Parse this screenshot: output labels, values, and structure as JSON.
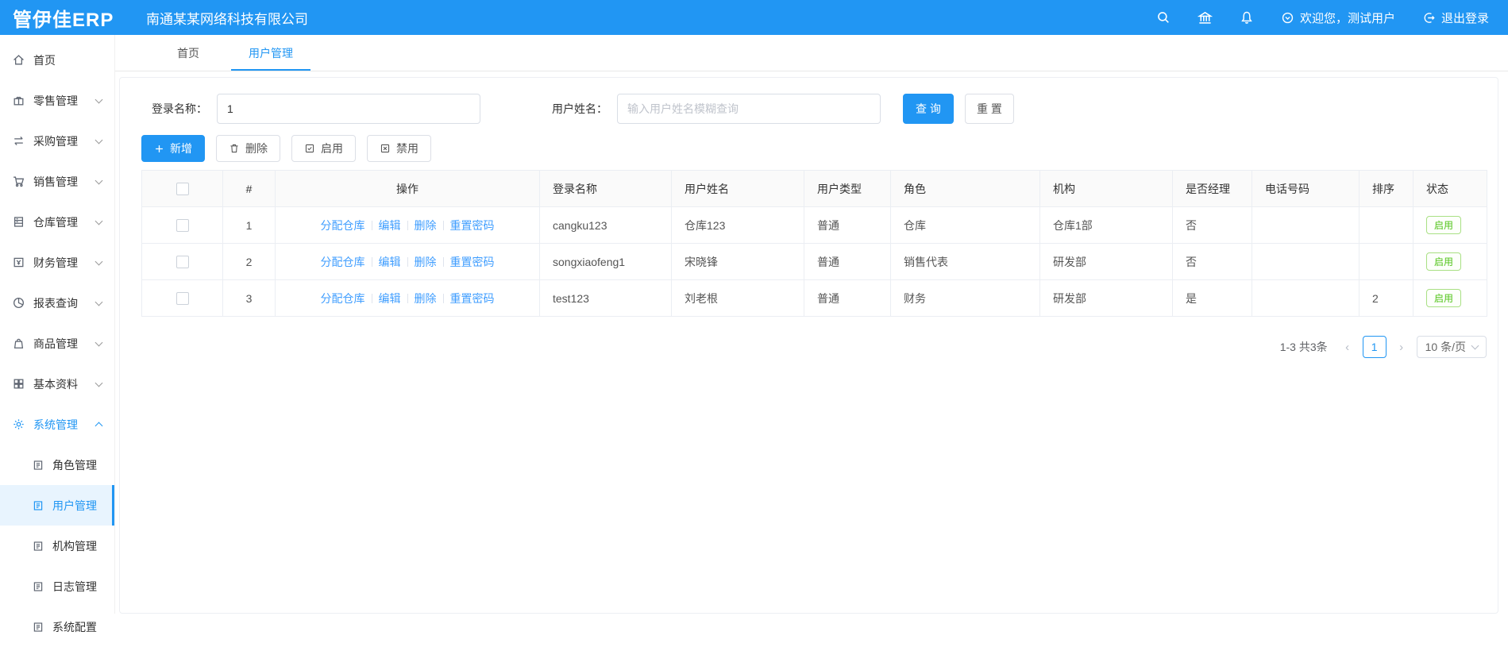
{
  "colors": {
    "primary": "#2196f3",
    "link": "#409eff",
    "success": "#52c41a"
  },
  "header": {
    "logo": "管伊佳ERP",
    "company": "南通某某网络科技有限公司",
    "welcome": "欢迎您，测试用户",
    "logout": "退出登录"
  },
  "sidebar": {
    "items": [
      {
        "label": "首页",
        "icon": "home"
      },
      {
        "label": "零售管理",
        "icon": "gift"
      },
      {
        "label": "采购管理",
        "icon": "swap-arrows"
      },
      {
        "label": "销售管理",
        "icon": "cart"
      },
      {
        "label": "仓库管理",
        "icon": "warehouse"
      },
      {
        "label": "财务管理",
        "icon": "finance"
      },
      {
        "label": "报表查询",
        "icon": "pie-chart"
      },
      {
        "label": "商品管理",
        "icon": "bag"
      },
      {
        "label": "基本资料",
        "icon": "grid"
      },
      {
        "label": "系统管理",
        "icon": "gear",
        "active": true,
        "expanded": true
      }
    ],
    "subitems": [
      {
        "label": "角色管理"
      },
      {
        "label": "用户管理",
        "active": true
      },
      {
        "label": "机构管理"
      },
      {
        "label": "日志管理"
      },
      {
        "label": "系统配置"
      }
    ]
  },
  "tabs": [
    {
      "label": "首页",
      "active": false
    },
    {
      "label": "用户管理",
      "active": true
    }
  ],
  "search": {
    "login_label": "登录名称：",
    "login_value": "1",
    "name_label": "用户姓名：",
    "name_placeholder": "输入用户姓名模糊查询",
    "query_label": "查 询",
    "reset_label": "重 置"
  },
  "toolbar": {
    "add_label": "新增",
    "delete_label": "删除",
    "enable_label": "启用",
    "disable_label": "禁用"
  },
  "table": {
    "headers": {
      "index": "#",
      "ops": "操作",
      "login": "登录名称",
      "name": "用户姓名",
      "type": "用户类型",
      "role": "角色",
      "org": "机构",
      "manager": "是否经理",
      "phone": "电话号码",
      "sort": "排序",
      "status": "状态"
    },
    "ops_links": [
      "分配仓库",
      "编辑",
      "删除",
      "重置密码"
    ],
    "rows": [
      {
        "index": "1",
        "login": "cangku123",
        "name": "仓库123",
        "type": "普通",
        "role": "仓库",
        "org": "仓库1部",
        "manager": "否",
        "phone": "",
        "sort": "",
        "status": "启用"
      },
      {
        "index": "2",
        "login": "songxiaofeng1",
        "name": "宋晓锋",
        "type": "普通",
        "role": "销售代表",
        "org": "研发部",
        "manager": "否",
        "phone": "",
        "sort": "",
        "status": "启用"
      },
      {
        "index": "3",
        "login": "test123",
        "name": "刘老根",
        "type": "普通",
        "role": "财务",
        "org": "研发部",
        "manager": "是",
        "phone": "",
        "sort": "2",
        "status": "启用"
      }
    ]
  },
  "pagination": {
    "total": "1-3 共3条",
    "prev": "‹",
    "page": "1",
    "next": "›",
    "page_size": "10 条/页"
  }
}
